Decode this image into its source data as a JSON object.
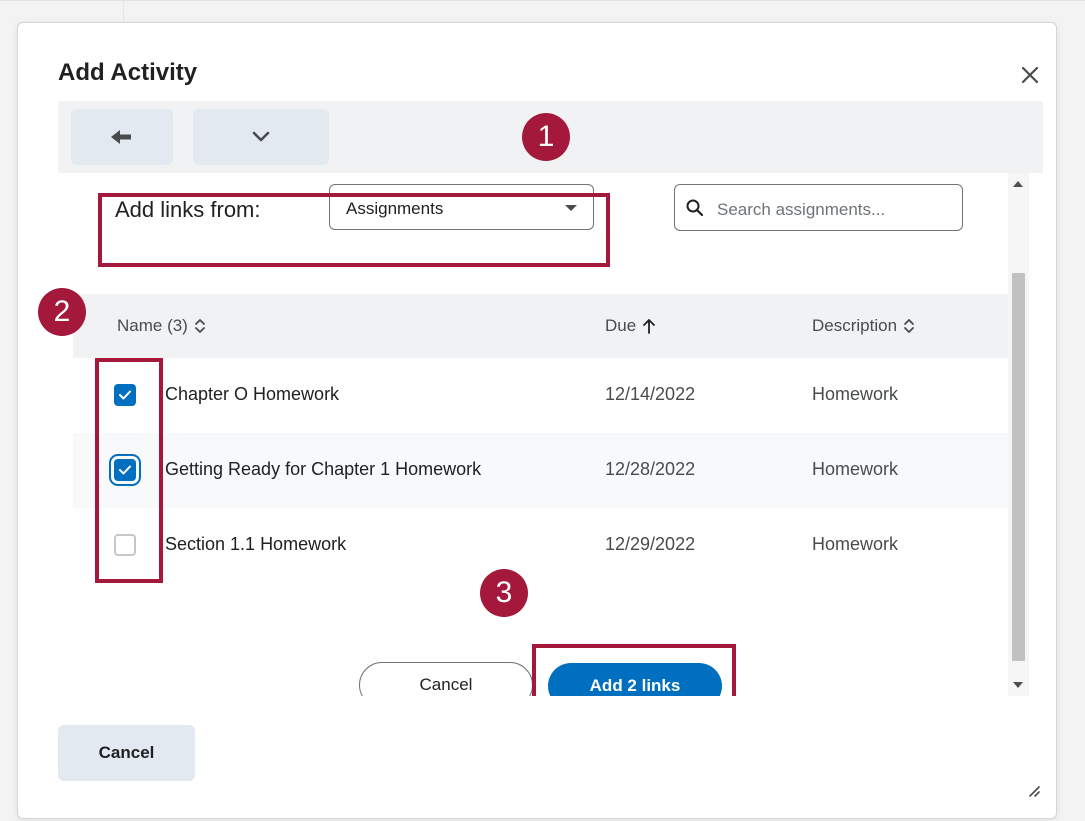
{
  "dialog": {
    "title": "Add Activity"
  },
  "panel": {
    "add_links_label": "Add links from:",
    "source_select": {
      "selected": "Assignments"
    },
    "search": {
      "placeholder": "Search assignments..."
    }
  },
  "table": {
    "headers": {
      "name": "Name (3)",
      "due": "Due",
      "description": "Description"
    },
    "rows": [
      {
        "name": "Chapter O Homework",
        "due": "12/14/2022",
        "description": "Homework",
        "checked": true
      },
      {
        "name": "Getting Ready for Chapter 1 Homework",
        "due": "12/28/2022",
        "description": "Homework",
        "checked": true
      },
      {
        "name": "Section 1.1 Homework",
        "due": "12/29/2022",
        "description": "Homework",
        "checked": false
      }
    ]
  },
  "actions": {
    "cancel_label": "Cancel",
    "add_label": "Add 2 links"
  },
  "footer": {
    "cancel_label": "Cancel"
  },
  "callouts": [
    "1",
    "2",
    "3"
  ],
  "colors": {
    "accent": "#006fbf",
    "callout": "#a3183b"
  },
  "icons": [
    "back-arrow-icon",
    "chevron-down-icon",
    "close-icon",
    "search-icon",
    "sort-icon",
    "arrow-up-icon",
    "checkmark-icon",
    "resize-grip-icon"
  ]
}
